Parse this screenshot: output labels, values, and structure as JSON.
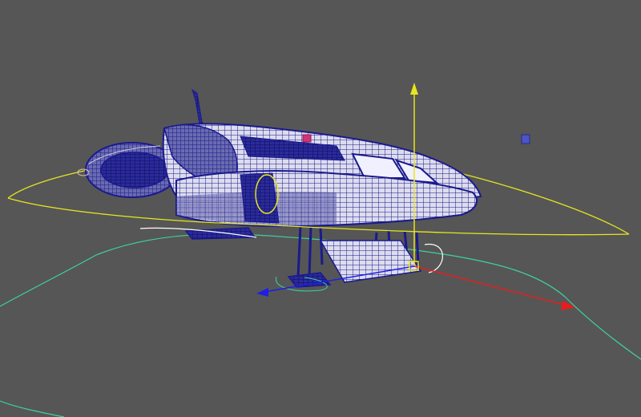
{
  "scene": {
    "background": "#565656",
    "wireframe_color": "#1a1a8c",
    "wire_light": "#c8c8e6",
    "selection_color": "#e6e61e",
    "control_curve_color": "#3cd2a0",
    "white_curve_color": "#ffffff",
    "axis_x_color": "#e61e1e",
    "axis_y_color": "#e6e61e",
    "axis_z_color": "#1e1ee6",
    "marker_color": "#d23278",
    "locator_color": "#4b55c8"
  },
  "icons": {
    "ship": "wireframe-spaceship",
    "gizmo": "move-manipulator",
    "locator": "locator-handle"
  }
}
